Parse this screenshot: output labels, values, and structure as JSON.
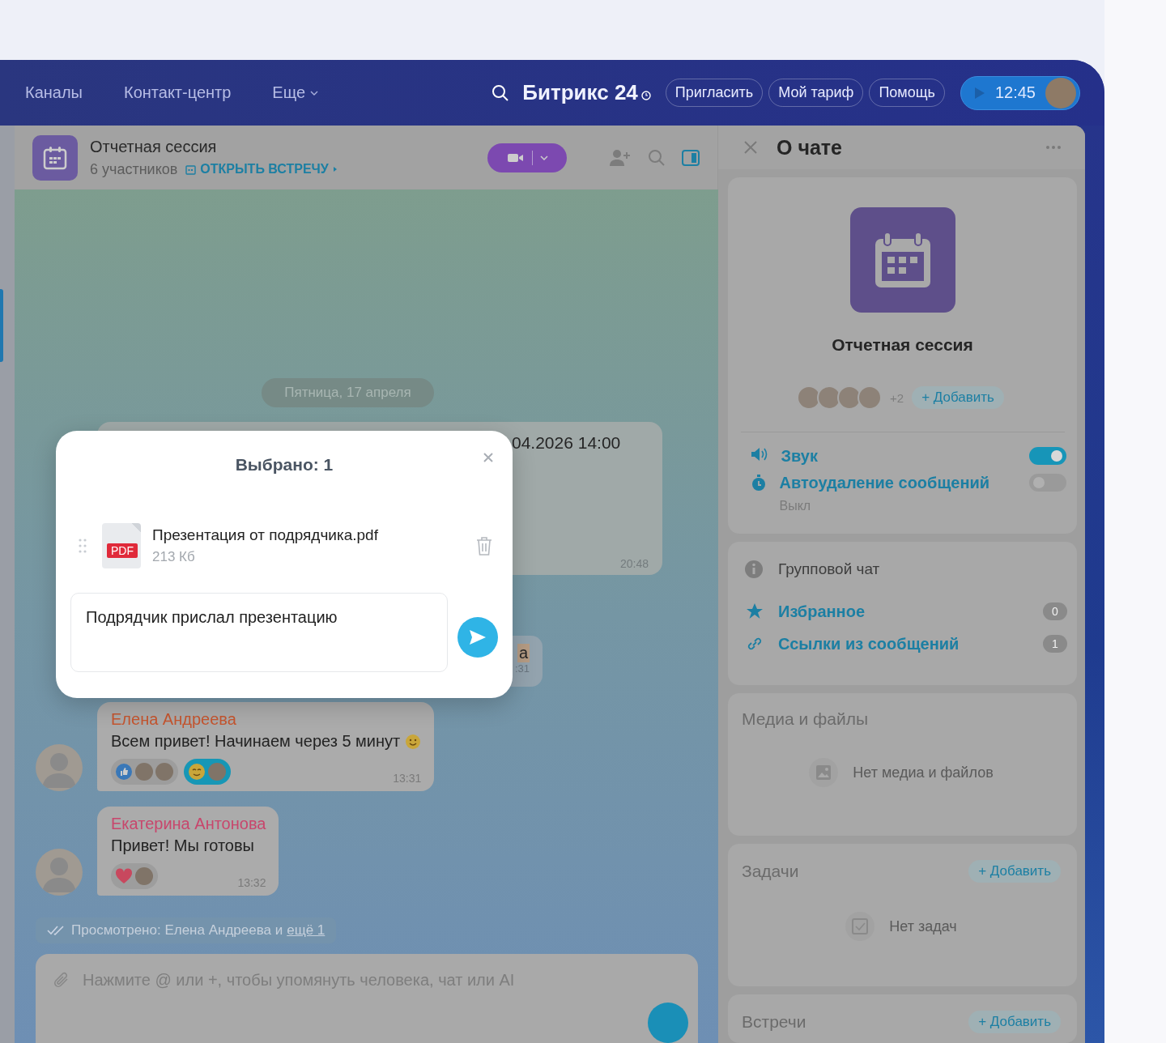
{
  "topbar": {
    "nav": [
      {
        "label": "Каналы",
        "dropdown": false
      },
      {
        "label": "Контакт-центр",
        "dropdown": false
      },
      {
        "label": "Еще",
        "dropdown": true
      }
    ],
    "logo": "Битрикс 24",
    "buttons": [
      "Пригласить",
      "Мой тариф",
      "Помощь"
    ],
    "time": "12:45"
  },
  "chat": {
    "title": "Отчетная сессия",
    "members": "6 участников",
    "meeting_link": "ОТКРЫТЬ ВСТРЕЧУ",
    "date": "Пятница, 17 апреля",
    "hidden_messages": [
      {
        "text": "04.2026 14:00",
        "time": "20:48"
      },
      {
        "text": "а",
        "time": ":31"
      }
    ],
    "messages": [
      {
        "author": "Елена Андреева",
        "color": "#c4552f",
        "text": "Всем привет! Начинаем через 5 минут",
        "time": "13:31",
        "reactions": [
          {
            "kind": "like",
            "selected": false,
            "reactors": [
              {
                "kind": "photo"
              },
              {
                "kind": "photo"
              }
            ]
          },
          {
            "kind": "smile",
            "selected": true,
            "reactors": [
              {
                "kind": "photo"
              }
            ]
          }
        ]
      },
      {
        "author": "Екатерина Антонова",
        "color": "#c8466c",
        "text": "Привет! Мы готовы",
        "time": "13:32",
        "reactions": [
          {
            "kind": "heart",
            "selected": false,
            "reactors": [
              {
                "kind": "photo"
              }
            ]
          }
        ]
      }
    ],
    "seen": "Просмотрено: Елена Андреева и",
    "seen_link": "ещё 1",
    "composer_placeholder": "Нажмите @ или +, чтобы упомянуть человека, чат или AI"
  },
  "modal": {
    "title": "Выбрано: 1",
    "file": {
      "name": "Презентация от подрядчика.pdf",
      "size": "213 Кб",
      "badge": "PDF"
    },
    "message": "Подрядчик прислал презентацию"
  },
  "panel": {
    "title": "О чате",
    "chat_name": "Отчетная сессия",
    "members": [
      {
        "kind": "photo"
      },
      {
        "kind": "photo"
      },
      {
        "kind": "photo"
      },
      {
        "kind": "photo"
      }
    ],
    "more_members": "+2",
    "add_label": "+ Добавить",
    "settings": [
      {
        "label": "Звук",
        "kind": "sound",
        "on": true
      },
      {
        "label": "Автоудаление сообщений",
        "kind": "timer",
        "on": false,
        "sub": "Выкл"
      }
    ],
    "chat_type": "Групповой чат",
    "links": [
      {
        "label": "Избранное",
        "kind": "favorites",
        "count": "0"
      },
      {
        "label": "Ссылки из сообщений",
        "kind": "links",
        "count": "1"
      }
    ],
    "sections": [
      {
        "title": "Медиа и файлы",
        "kind": "media",
        "empty": "Нет медиа и файлов"
      },
      {
        "title": "Задачи",
        "kind": "tasks",
        "add": "+ Добавить",
        "empty": "Нет задач"
      },
      {
        "title": "Встречи",
        "add": "+ Добавить"
      }
    ]
  }
}
